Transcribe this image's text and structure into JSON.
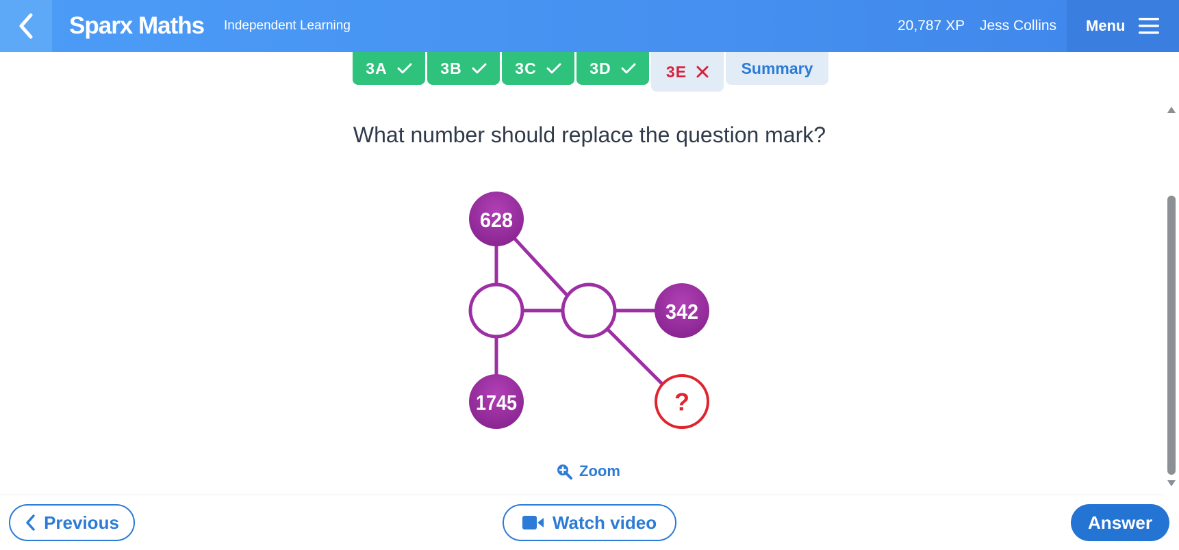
{
  "header": {
    "brand": "Sparx Maths",
    "subtitle": "Independent Learning",
    "xp": "20,787 XP",
    "username": "Jess Collins",
    "menu_label": "Menu"
  },
  "tabs": [
    {
      "label": "3A",
      "status": "done"
    },
    {
      "label": "3B",
      "status": "done"
    },
    {
      "label": "3C",
      "status": "done"
    },
    {
      "label": "3D",
      "status": "done"
    },
    {
      "label": "3E",
      "status": "wrong"
    },
    {
      "label": "Summary",
      "status": "summary"
    }
  ],
  "question": {
    "text": "What number should replace the question mark?",
    "nodes": {
      "top": "628",
      "right": "342",
      "bottom": "1745",
      "unknown": "?"
    }
  },
  "zoom_label": "Zoom",
  "footer": {
    "previous_label": "Previous",
    "video_label": "Watch video",
    "answer_label": "Answer"
  },
  "colors": {
    "header_blue": "#4590f0",
    "tab_done_green": "#2fc27c",
    "tab_wrong_red": "#d6223c",
    "node_purple": "#9c2fa3",
    "unknown_red": "#e0232d",
    "action_blue": "#2474d4"
  },
  "icons": {
    "back": "chevron-left-icon",
    "menu": "hamburger-icon",
    "check": "check-icon",
    "cross": "cross-icon",
    "zoom": "zoom-in-icon",
    "video": "video-camera-icon",
    "previous": "chevron-left-icon"
  }
}
